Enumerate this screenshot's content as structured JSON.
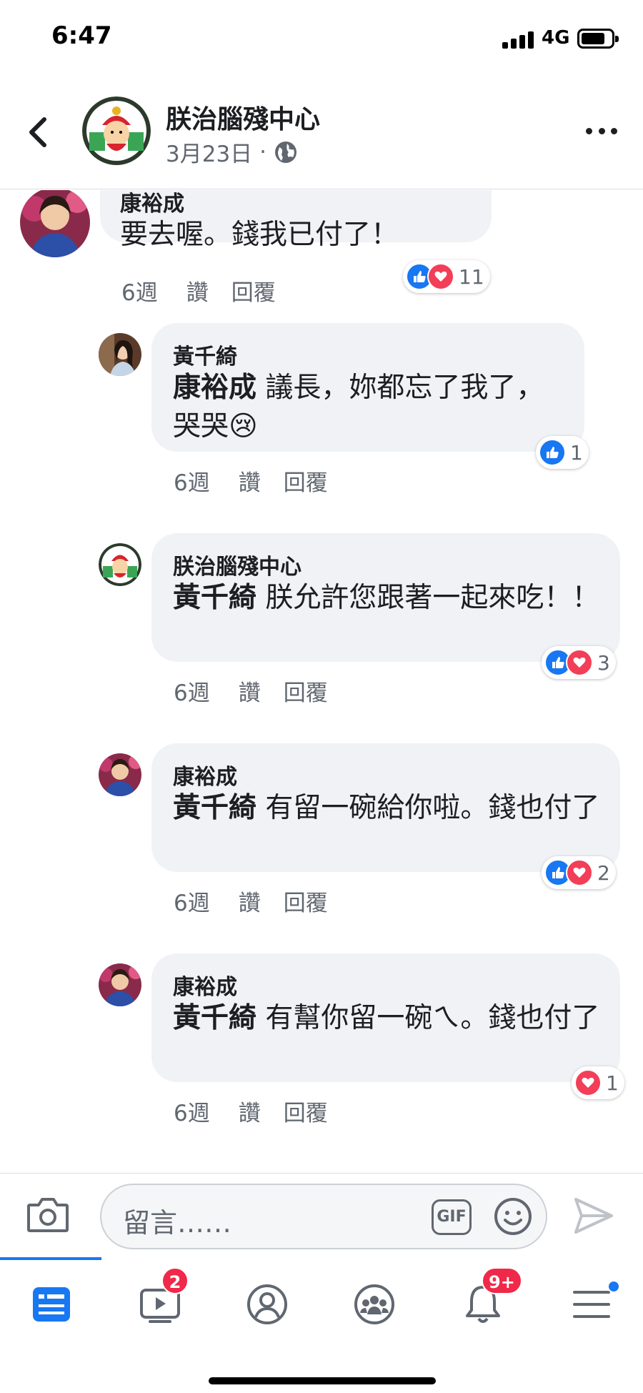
{
  "status_bar": {
    "time": "6:47",
    "network": "4G"
  },
  "header": {
    "page_name": "朕治腦殘中心",
    "post_date": "3月23日",
    "separator": "·"
  },
  "comments": [
    {
      "author": "康裕成",
      "mention": "",
      "text": "要去喔。錢我已付了！",
      "time": "6週",
      "like_label": "讚",
      "reply_label": "回覆",
      "reactions": [
        "like",
        "love"
      ],
      "reaction_count": "11"
    },
    {
      "author": "黃千綺",
      "mention": "康裕成",
      "text": " 議長，妳都忘了我了，哭哭😢",
      "time": "6週",
      "like_label": "讚",
      "reply_label": "回覆",
      "reactions": [
        "like"
      ],
      "reaction_count": "1"
    },
    {
      "author": "朕治腦殘中心",
      "mention": "黃千綺",
      "text": " 朕允許您跟著一起來吃！！",
      "time": "6週",
      "like_label": "讚",
      "reply_label": "回覆",
      "reactions": [
        "like",
        "love"
      ],
      "reaction_count": "3"
    },
    {
      "author": "康裕成",
      "mention": "黃千綺",
      "text": " 有留一碗給你啦。錢也付了",
      "time": "6週",
      "like_label": "讚",
      "reply_label": "回覆",
      "reactions": [
        "like",
        "love"
      ],
      "reaction_count": "2"
    },
    {
      "author": "康裕成",
      "mention": "黃千綺",
      "text": " 有幫你留一碗ㄟ。錢也付了",
      "time": "6週",
      "like_label": "讚",
      "reply_label": "回覆",
      "reactions": [
        "love"
      ],
      "reaction_count": "1"
    }
  ],
  "composer": {
    "placeholder": "留言……",
    "gif_label": "GIF"
  },
  "tabbar": {
    "tabs": [
      {
        "icon": "news-feed-icon",
        "badge": ""
      },
      {
        "icon": "watch-icon",
        "badge": "2"
      },
      {
        "icon": "profile-icon",
        "badge": ""
      },
      {
        "icon": "groups-icon",
        "badge": ""
      },
      {
        "icon": "notifications-icon",
        "badge": "9+"
      },
      {
        "icon": "menu-icon",
        "badge": ""
      }
    ]
  },
  "colors": {
    "accent": "#1877f2",
    "love": "#f33e58",
    "badge": "#f02849",
    "bubble": "#f0f2f5",
    "secondary_text": "#606770"
  }
}
